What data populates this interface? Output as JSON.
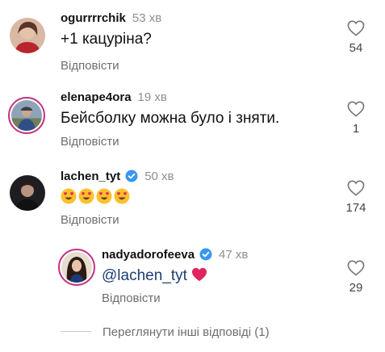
{
  "comments": [
    {
      "username": "ogurrrrchik",
      "time": "53 хв",
      "text": "+1 кацуріна?",
      "reply_label": "Відповісти",
      "likes": "54",
      "verified": false,
      "avatar": "woman-avatar"
    },
    {
      "username": "elenape4ora",
      "time": "19 хв",
      "text": "Бейсболку можна було і зняти.",
      "reply_label": "Відповісти",
      "likes": "1",
      "verified": false,
      "avatar": "person-outdoor-avatar"
    },
    {
      "username": "lachen_tyt",
      "time": "50 хв",
      "emojis": [
        "heart-eyes-emoji",
        "heart-eyes-emoji",
        "heart-eyes-emoji",
        "heart-eyes-emoji"
      ],
      "reply_label": "Відповісти",
      "likes": "174",
      "verified": true,
      "avatar": "man-avatar"
    }
  ],
  "reply": {
    "username": "nadyadorofeeva",
    "time": "47 хв",
    "mention": "@lachen_tyt",
    "emoji": "red-heart-emoji",
    "reply_label": "Відповісти",
    "likes": "29",
    "verified": true,
    "avatar": "woman-dark-hair-avatar"
  },
  "view_more_replies": "Переглянути інші відповіді (1)",
  "colors": {
    "verified_blue": "#3897f0",
    "story_ring": "#c13584",
    "mention_blue": "#1c3f73",
    "heart_red": "#e0245e",
    "emoji_yellow": "#fbc02d"
  }
}
